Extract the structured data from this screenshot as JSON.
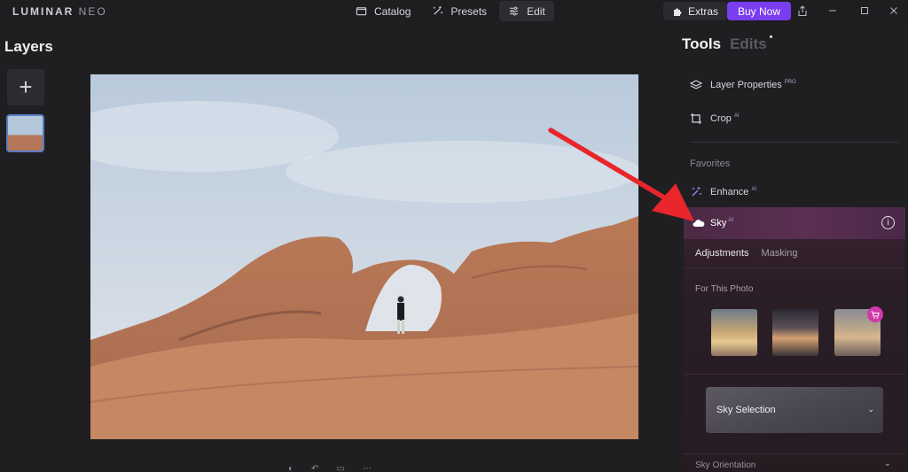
{
  "app": {
    "logo_main": "LUMINAR",
    "logo_sub": "NEO"
  },
  "modes": [
    {
      "label": "Catalog",
      "icon": "folder-icon"
    },
    {
      "label": "Presets",
      "icon": "sparkle-wand-icon"
    },
    {
      "label": "Edit",
      "icon": "sliders-icon"
    }
  ],
  "topbar": {
    "extras_label": "Extras",
    "buy_label": "Buy Now",
    "buy_color": "#7a3df0"
  },
  "left": {
    "title": "Layers",
    "add_label": "+"
  },
  "right": {
    "tab_tools": "Tools",
    "tab_edits": "Edits",
    "layer_properties": "Layer Properties",
    "layer_properties_tag": "PRO",
    "crop": "Crop",
    "crop_tag": "AI",
    "favorites": "Favorites",
    "enhance": "Enhance",
    "enhance_tag": "AI",
    "sky": "Sky",
    "sky_tag": "AI",
    "info_icon": "i",
    "tab_adjustments": "Adjustments",
    "tab_masking": "Masking",
    "for_this_photo": "For This Photo",
    "sky_selection": "Sky Selection",
    "sky_orientation": "Sky Orientation",
    "accent_color": "#e8262b"
  }
}
